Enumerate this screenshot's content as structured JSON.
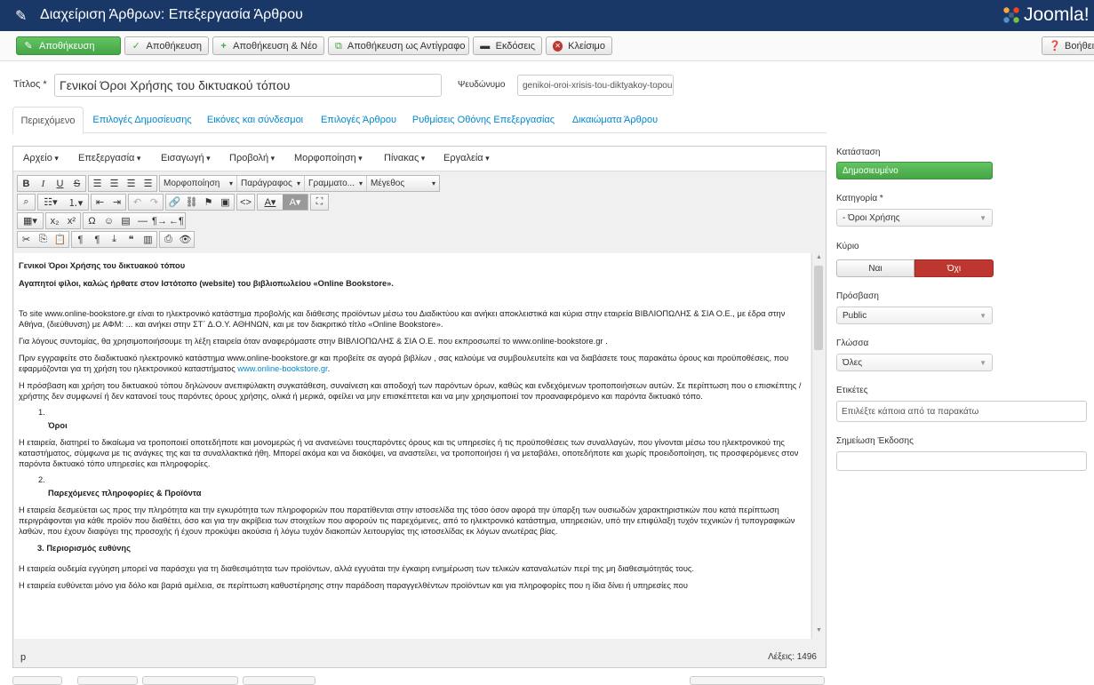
{
  "header": {
    "title": "Διαχείριση Άρθρων: Επεξεργασία Άρθρου",
    "brand": "Joomla!"
  },
  "toolbar": {
    "buttons": [
      {
        "label": "Αποθήκευση",
        "icon": "✎"
      },
      {
        "label": "Αποθήκευση",
        "icon": "✓"
      },
      {
        "label": "Αποθήκευση & Νέο",
        "icon": "+"
      },
      {
        "label": "Αποθήκευση ως Αντίγραφο",
        "icon": "⧉"
      },
      {
        "label": "Εκδόσεις",
        "icon": "▬"
      },
      {
        "label": "Κλείσιμο",
        "icon": "✕"
      }
    ],
    "help": "Βοήθεια"
  },
  "form": {
    "title_label": "Τίτλος *",
    "title_value": "Γενικοί Όροι Χρήσης του δικτυακού τόπου",
    "alias_label": "Ψευδώνυμο",
    "alias_value": "genikoi-oroi-xrisis-tou-diktyakoy-topou"
  },
  "tabs": [
    "Περιεχόμενο",
    "Επιλογές Δημοσίευσης",
    "Εικόνες και σύνδεσμοι",
    "Επιλογές Άρθρου",
    "Ρυθμίσεις Οθόνης Επεξεργασίας",
    "Δικαιώματα Άρθρου"
  ],
  "editor": {
    "menu": [
      "Αρχείο",
      "Επεξεργασία",
      "Εισαγωγή",
      "Προβολή",
      "Μορφοποίηση",
      "Πίνακας",
      "Εργαλεία"
    ],
    "selects": {
      "format": "Μορφοποίηση",
      "paragraph": "Παράγραφος",
      "font": "Γραμματο...",
      "size": "Μέγεθος"
    },
    "content": {
      "h1": "Γενικοί Όροι Χρήσης του δικτυακού τόπου",
      "h2": "Αγαπητοί φίλοι, καλώς ήρθατε στον Ιστότοπο (website) του βιβλιοπωλείου «Online Bookstore».",
      "p1": "Το site www.online-bookstore.gr είναι το ηλεκτρονικό κατάστημα προβολής και διάθεσης προϊόντων μέσω του Διαδικτύου και ανήκει αποκλειστικά και κύρια στην εταιρεία ΒΙΒΛΙΟΠΩΛΗΣ & ΣΙΑ Ο.Ε., με έδρα στην Αθήνα, (διεύθυνση) με ΑΦΜ: ... και ανήκει στην ΣΤ΄ Δ.Ο.Υ. ΑΘΗΝΩΝ, και με τον διακριτικό τίτλο «Online Bookstore».",
      "p2": "Για λόγους συντομίας, θα χρησιμοποιήσουμε τη λέξη εταιρεία όταν αναφερόμαστε στην ΒΙΒΛΙΟΠΩΛΗΣ & ΣΙΑ Ο.Ε. που εκπροσωπεί το www.online-bookstore.gr .",
      "p3_a": "Πριν εγγραφείτε στο διαδικτυακό ηλεκτρονικό κατάστημα www.online-bookstore.gr και προβείτε σε αγορά βιβλίων , σας καλούμε να συμβουλευτείτε και να διαβάσετε τους παρακάτω όρους και προϋποθέσεις, που εφαρμόζονται για τη χρήση του ηλεκτρονικού καταστήματος ",
      "p3_link": "www.online-bookstore.gr",
      "p3_b": ".",
      "p4": "Η πρόσβαση και χρήση του δικτυακού τόπου δηλώνουν ανεπιφύλακτη συγκατάθεση, συναίνεση και αποδοχή των παρόντων όρων, καθώς και ενδεχόμενων τροποποιήσεων αυτών. Σε περίπτωση που ο επισκέπτης / χρήστης δεν συμφωνεί ή δεν κατανοεί τους παρόντες όρους χρήσης, ολικά ή μερικά, οφείλει να μην επισκέπτεται και να μην χρησιμοποιεί τον προαναφερόμενο και παρόντα δικτυακό τόπο.",
      "n1": "1.",
      "s1": "Όροι",
      "p5": "Η εταιρεία, διατηρεί το δικαίωμα να τροποποιεί οποτεδήποτε και μονομερώς ή να ανανεώνει τουςπαρόντες όρους και τις υπηρεσίες ή τις προϋποθέσεις των συναλλαγών, που γίνονται μέσω του ηλεκτρονικού της καταστήματος, σύμφωνα με τις ανάγκες της και τα συναλλακτικά ήθη. Μπορεί ακόμα και να διακόψει, να αναστείλει, να τροποποιήσει ή να μεταβάλει, οποτεδήποτε και χωρίς προειδοποίηση, τις προσφερόμενες στον παρόντα δικτυακό τόπο υπηρεσίες και πληροφορίες.",
      "n2": "2.",
      "s2": "Παρεχόμενες πληροφορίες & Προϊόντα",
      "p6": "Η εταιρεία δεσμεύεται ως προς την πληρότητα και την εγκυρότητα των πληροφοριών που παρατίθενται στην ιστοσελίδα της τόσο όσον αφορά την ύπαρξη των ουσιωδών χαρακτηριστικών που κατά περίπτωση περιγράφονται για κάθε προϊόν που διαθέτει, όσο και για την ακρίβεια των στοιχείων που αφορούν τις παρεχόμενες, από το ηλεκτρονικό κατάστημα, υπηρεσιών, υπό την επιφύλαξη τυχόν τεχνικών ή τυπογραφικών λαθών, που έχουν διαφύγει της προσοχής ή έχουν προκύψει ακούσια ή λόγω τυχόν διακοπών λειτουργίας της ιστοσελίδας εκ λόγων ανωτέρας βίας.",
      "s3": "3. Περιορισμός ευθύνης",
      "p7": "Η εταιρεία ουδεμία εγγύηση μπορεί να παράσχει για τη διαθεσιμότητα των προϊόντων, αλλά εγγυάται την έγκαιρη ενημέρωση των τελικών καταναλωτών περί της μη διαθεσιμότητάς τους.",
      "p8": "Η εταιρεία ευθύνεται μόνο για δόλο και βαριά αμέλεια, σε περίπτωση καθυστέρησης στην παράδοση παραγγελθέντων προϊόντων και για πληροφορίες που η ίδια δίνει ή υπηρεσίες που"
    },
    "path": "p",
    "wordcount": "Λέξεις: 1496"
  },
  "sidebar": {
    "status_label": "Κατάσταση",
    "status_value": "Δημοσιευμένο",
    "category_label": "Κατηγορία *",
    "category_value": "- Όροι Χρήσης",
    "featured_label": "Κύριο",
    "featured_yes": "Ναι",
    "featured_no": "Όχι",
    "access_label": "Πρόσβαση",
    "access_value": "Public",
    "language_label": "Γλώσσα",
    "language_value": "Όλες",
    "tags_label": "Ετικέτες",
    "tags_placeholder": "Επιλέξτε κάποια από τα παρακάτω",
    "version_label": "Σημείωση Έκδοσης",
    "version_value": ""
  },
  "colors": {
    "header_bg": "#1a3867",
    "green": "#46a546",
    "red": "#bd362f",
    "link": "#0088cc"
  }
}
